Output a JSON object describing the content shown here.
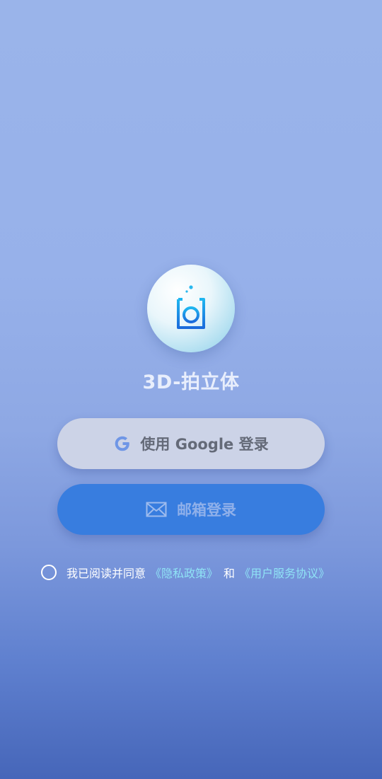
{
  "app": {
    "name": "3D-拍立体",
    "logo_icon": "camera-box-icon"
  },
  "login": {
    "google_label": "使用 Google 登录",
    "google_icon": "google-icon",
    "email_label": "邮箱登录",
    "email_icon": "envelope-icon"
  },
  "agreement": {
    "text": "我已阅读并同意",
    "privacy_link": "《隐私政策》",
    "conjunction": "和",
    "service_link": "《用户服务协议》",
    "checked": false
  },
  "colors": {
    "primary_button": "#387ddf",
    "google_button": "#ccd3e7",
    "link": "#8fe3f5"
  }
}
